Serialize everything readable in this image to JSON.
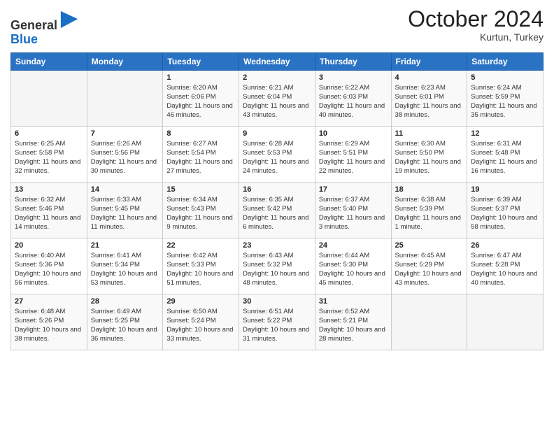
{
  "logo": {
    "line1": "General",
    "line2": "Blue"
  },
  "header": {
    "month_year": "October 2024",
    "location": "Kurtun, Turkey"
  },
  "days_of_week": [
    "Sunday",
    "Monday",
    "Tuesday",
    "Wednesday",
    "Thursday",
    "Friday",
    "Saturday"
  ],
  "weeks": [
    [
      {
        "day": null
      },
      {
        "day": null
      },
      {
        "day": "1",
        "sunrise": "6:20 AM",
        "sunset": "6:06 PM",
        "daylight": "11 hours and 46 minutes."
      },
      {
        "day": "2",
        "sunrise": "6:21 AM",
        "sunset": "6:04 PM",
        "daylight": "11 hours and 43 minutes."
      },
      {
        "day": "3",
        "sunrise": "6:22 AM",
        "sunset": "6:03 PM",
        "daylight": "11 hours and 40 minutes."
      },
      {
        "day": "4",
        "sunrise": "6:23 AM",
        "sunset": "6:01 PM",
        "daylight": "11 hours and 38 minutes."
      },
      {
        "day": "5",
        "sunrise": "6:24 AM",
        "sunset": "5:59 PM",
        "daylight": "11 hours and 35 minutes."
      }
    ],
    [
      {
        "day": "6",
        "sunrise": "6:25 AM",
        "sunset": "5:58 PM",
        "daylight": "11 hours and 32 minutes."
      },
      {
        "day": "7",
        "sunrise": "6:26 AM",
        "sunset": "5:56 PM",
        "daylight": "11 hours and 30 minutes."
      },
      {
        "day": "8",
        "sunrise": "6:27 AM",
        "sunset": "5:54 PM",
        "daylight": "11 hours and 27 minutes."
      },
      {
        "day": "9",
        "sunrise": "6:28 AM",
        "sunset": "5:53 PM",
        "daylight": "11 hours and 24 minutes."
      },
      {
        "day": "10",
        "sunrise": "6:29 AM",
        "sunset": "5:51 PM",
        "daylight": "11 hours and 22 minutes."
      },
      {
        "day": "11",
        "sunrise": "6:30 AM",
        "sunset": "5:50 PM",
        "daylight": "11 hours and 19 minutes."
      },
      {
        "day": "12",
        "sunrise": "6:31 AM",
        "sunset": "5:48 PM",
        "daylight": "11 hours and 16 minutes."
      }
    ],
    [
      {
        "day": "13",
        "sunrise": "6:32 AM",
        "sunset": "5:46 PM",
        "daylight": "11 hours and 14 minutes."
      },
      {
        "day": "14",
        "sunrise": "6:33 AM",
        "sunset": "5:45 PM",
        "daylight": "11 hours and 11 minutes."
      },
      {
        "day": "15",
        "sunrise": "6:34 AM",
        "sunset": "5:43 PM",
        "daylight": "11 hours and 9 minutes."
      },
      {
        "day": "16",
        "sunrise": "6:35 AM",
        "sunset": "5:42 PM",
        "daylight": "11 hours and 6 minutes."
      },
      {
        "day": "17",
        "sunrise": "6:37 AM",
        "sunset": "5:40 PM",
        "daylight": "11 hours and 3 minutes."
      },
      {
        "day": "18",
        "sunrise": "6:38 AM",
        "sunset": "5:39 PM",
        "daylight": "11 hours and 1 minute."
      },
      {
        "day": "19",
        "sunrise": "6:39 AM",
        "sunset": "5:37 PM",
        "daylight": "10 hours and 58 minutes."
      }
    ],
    [
      {
        "day": "20",
        "sunrise": "6:40 AM",
        "sunset": "5:36 PM",
        "daylight": "10 hours and 56 minutes."
      },
      {
        "day": "21",
        "sunrise": "6:41 AM",
        "sunset": "5:34 PM",
        "daylight": "10 hours and 53 minutes."
      },
      {
        "day": "22",
        "sunrise": "6:42 AM",
        "sunset": "5:33 PM",
        "daylight": "10 hours and 51 minutes."
      },
      {
        "day": "23",
        "sunrise": "6:43 AM",
        "sunset": "5:32 PM",
        "daylight": "10 hours and 48 minutes."
      },
      {
        "day": "24",
        "sunrise": "6:44 AM",
        "sunset": "5:30 PM",
        "daylight": "10 hours and 45 minutes."
      },
      {
        "day": "25",
        "sunrise": "6:45 AM",
        "sunset": "5:29 PM",
        "daylight": "10 hours and 43 minutes."
      },
      {
        "day": "26",
        "sunrise": "6:47 AM",
        "sunset": "5:28 PM",
        "daylight": "10 hours and 40 minutes."
      }
    ],
    [
      {
        "day": "27",
        "sunrise": "6:48 AM",
        "sunset": "5:26 PM",
        "daylight": "10 hours and 38 minutes."
      },
      {
        "day": "28",
        "sunrise": "6:49 AM",
        "sunset": "5:25 PM",
        "daylight": "10 hours and 36 minutes."
      },
      {
        "day": "29",
        "sunrise": "6:50 AM",
        "sunset": "5:24 PM",
        "daylight": "10 hours and 33 minutes."
      },
      {
        "day": "30",
        "sunrise": "6:51 AM",
        "sunset": "5:22 PM",
        "daylight": "10 hours and 31 minutes."
      },
      {
        "day": "31",
        "sunrise": "6:52 AM",
        "sunset": "5:21 PM",
        "daylight": "10 hours and 28 minutes."
      },
      {
        "day": null
      },
      {
        "day": null
      }
    ]
  ]
}
